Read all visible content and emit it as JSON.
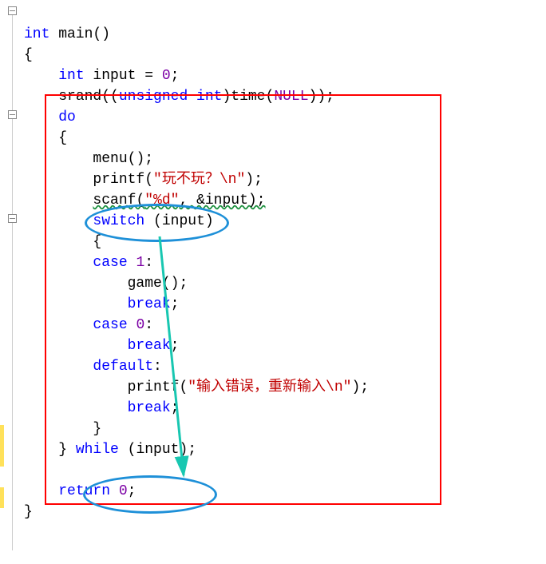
{
  "code": {
    "l1_kw": "int",
    "l1_fn": " main",
    "l1_paren": "()",
    "l2": "{",
    "l3_indent": "    ",
    "l3_kw": "int",
    "l3_rest": " input = ",
    "l3_num": "0",
    "l3_semi": ";",
    "l4_indent": "    ",
    "l4_fn": "srand",
    "l4_p1": "((",
    "l4_kw": "unsigned int",
    "l4_p2": ")",
    "l4_fn2": "time",
    "l4_p3": "(",
    "l4_null": "NULL",
    "l4_p4": "));",
    "l5_indent": "    ",
    "l5_kw": "do",
    "l6_indent": "    ",
    "l6_brace": "{",
    "l7_indent": "        ",
    "l7_fn": "menu",
    "l7_rest": "();",
    "l8_indent": "        ",
    "l8_fn": "printf",
    "l8_p1": "(",
    "l8_str": "\"玩不玩？\\n\"",
    "l8_p2": ");",
    "l9_indent": "        ",
    "l9_fn": "scanf",
    "l9_p1": "(",
    "l9_str": "\"%d\"",
    "l9_mid": ", &input);",
    "l10_indent": "        ",
    "l10_kw": "switch",
    "l10_rest": " (input)",
    "l11_indent": "        ",
    "l11_brace": "{",
    "l12_indent": "        ",
    "l12_kw": "case",
    "l12_sp": " ",
    "l12_num": "1",
    "l12_colon": ":",
    "l13_indent": "            ",
    "l13_fn": "game",
    "l13_rest": "();",
    "l14_indent": "            ",
    "l14_kw": "break",
    "l14_semi": ";",
    "l15_indent": "        ",
    "l15_kw": "case",
    "l15_sp": " ",
    "l15_num": "0",
    "l15_colon": ":",
    "l16_indent": "            ",
    "l16_kw": "break",
    "l16_semi": ";",
    "l17_indent": "        ",
    "l17_kw": "default",
    "l17_colon": ":",
    "l18_indent": "            ",
    "l18_fn": "printf",
    "l18_p1": "(",
    "l18_str": "\"输入错误，重新输入\\n\"",
    "l18_p2": ");",
    "l19_indent": "            ",
    "l19_kw": "break",
    "l19_semi": ";",
    "l20_indent": "        ",
    "l20_brace": "}",
    "l21_indent": "    ",
    "l21_brace": "} ",
    "l21_kw": "while",
    "l21_rest": " (input);",
    "l22": "",
    "l23_indent": "    ",
    "l23_kw": "return",
    "l23_sp": " ",
    "l23_num": "0",
    "l23_semi": ";",
    "l24": "}"
  }
}
